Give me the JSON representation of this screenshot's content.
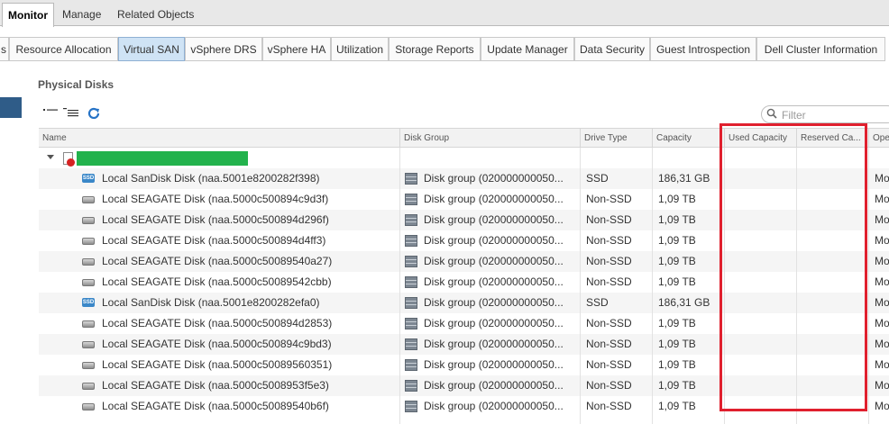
{
  "top_tabs": [
    "Monitor",
    "Manage",
    "Related Objects"
  ],
  "sub_tabs": [
    "s",
    "Resource Allocation",
    "Virtual SAN",
    "vSphere DRS",
    "vSphere HA",
    "Utilization",
    "Storage Reports",
    "Update Manager",
    "Data Security",
    "Guest Introspection",
    "Dell Cluster Information"
  ],
  "panel": {
    "title": "Physical Disks",
    "filter_placeholder": "Filter"
  },
  "columns": [
    "Name",
    "Disk Group",
    "Drive Type",
    "Capacity",
    "Used Capacity",
    "Reserved Ca...",
    "Ope"
  ],
  "rows": [
    {
      "icon": "ssd-icon",
      "name": "Local SanDisk Disk (naa.5001e8200282f398)",
      "group": "Disk group (020000000050...",
      "type": "SSD",
      "capacity": "186,31 GB",
      "op": "Mo"
    },
    {
      "icon": "hdd-icon",
      "name": "Local SEAGATE Disk (naa.5000c500894c9d3f)",
      "group": "Disk group (020000000050...",
      "type": "Non-SSD",
      "capacity": "1,09 TB",
      "op": "Mo"
    },
    {
      "icon": "hdd-icon",
      "name": "Local SEAGATE Disk (naa.5000c500894d296f)",
      "group": "Disk group (020000000050...",
      "type": "Non-SSD",
      "capacity": "1,09 TB",
      "op": "Mo"
    },
    {
      "icon": "hdd-icon",
      "name": "Local SEAGATE Disk (naa.5000c500894d4ff3)",
      "group": "Disk group (020000000050...",
      "type": "Non-SSD",
      "capacity": "1,09 TB",
      "op": "Mo"
    },
    {
      "icon": "hdd-icon",
      "name": "Local SEAGATE Disk (naa.5000c50089540a27)",
      "group": "Disk group (020000000050...",
      "type": "Non-SSD",
      "capacity": "1,09 TB",
      "op": "Mo"
    },
    {
      "icon": "hdd-icon",
      "name": "Local SEAGATE Disk (naa.5000c50089542cbb)",
      "group": "Disk group (020000000050...",
      "type": "Non-SSD",
      "capacity": "1,09 TB",
      "op": "Mo"
    },
    {
      "icon": "ssd-icon",
      "name": "Local SanDisk Disk (naa.5001e8200282efa0)",
      "group": "Disk group (020000000050...",
      "type": "SSD",
      "capacity": "186,31 GB",
      "op": "Mo"
    },
    {
      "icon": "hdd-icon",
      "name": "Local SEAGATE Disk (naa.5000c500894d2853)",
      "group": "Disk group (020000000050...",
      "type": "Non-SSD",
      "capacity": "1,09 TB",
      "op": "Mo"
    },
    {
      "icon": "hdd-icon",
      "name": "Local SEAGATE Disk (naa.5000c500894c9bd3)",
      "group": "Disk group (020000000050...",
      "type": "Non-SSD",
      "capacity": "1,09 TB",
      "op": "Mo"
    },
    {
      "icon": "hdd-icon",
      "name": "Local SEAGATE Disk (naa.5000c50089560351)",
      "group": "Disk group (020000000050...",
      "type": "Non-SSD",
      "capacity": "1,09 TB",
      "op": "Mo"
    },
    {
      "icon": "hdd-icon",
      "name": "Local SEAGATE Disk (naa.5000c5008953f5e3)",
      "group": "Disk group (020000000050...",
      "type": "Non-SSD",
      "capacity": "1,09 TB",
      "op": "Mo"
    },
    {
      "icon": "hdd-icon",
      "name": "Local SEAGATE Disk (naa.5000c50089540b6f)",
      "group": "Disk group (020000000050...",
      "type": "Non-SSD",
      "capacity": "1,09 TB",
      "op": "Mo"
    }
  ],
  "colors": {
    "highlight": "#e0202e",
    "redaction": "#22b24c",
    "active_subtab": "#cfe3f5"
  },
  "icons": [
    "collapse-all-icon",
    "expand-all-icon",
    "refresh-icon",
    "search-icon",
    "host-error-icon",
    "ssd-icon",
    "hdd-icon",
    "disk-group-icon"
  ]
}
